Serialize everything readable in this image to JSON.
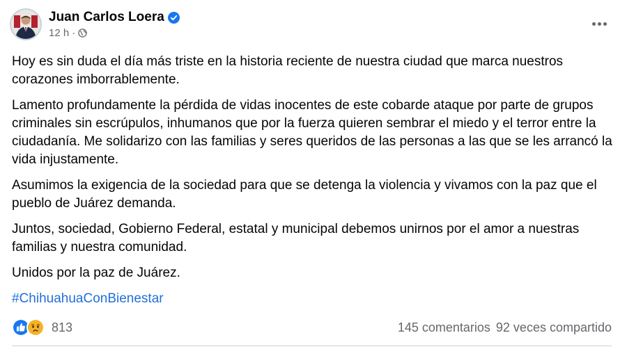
{
  "post": {
    "author": "Juan Carlos Loera",
    "time": "12 h",
    "separator": "·",
    "paragraphs": [
      "Hoy es sin duda el día más triste en la historia reciente de nuestra ciudad que marca nuestros corazones imborrablemente.",
      "Lamento profundamente la pérdida de vidas inocentes de este cobarde ataque por parte de grupos criminales sin escrúpulos, inhumanos que por la fuerza quieren sembrar el miedo y el terror entre la ciudadanía. Me solidarizo con las familias y seres queridos de las personas a las que se les arrancó la vida injustamente.",
      "Asumimos la exigencia de la sociedad para que se detenga la violencia y vivamos con la paz que el pueblo de Juárez demanda.",
      "Juntos, sociedad, Gobierno Federal, estatal y municipal debemos unirnos por el amor a nuestras familias y nuestra comunidad.",
      "Unidos por la paz de Juárez."
    ],
    "hashtag": "#ChihuahuaConBienestar"
  },
  "footer": {
    "reaction_count": "813",
    "comments": "145 comentarios",
    "shares": "92 veces compartido"
  },
  "icons": {
    "verified": "verified-badge-icon",
    "privacy": "globe-icon",
    "more": "more-options-icon",
    "reactions": [
      "like-icon",
      "sad-icon"
    ]
  },
  "colors": {
    "text": "#050505",
    "secondary_text": "#65676b",
    "link": "#216fdb",
    "verified": "#1877f2",
    "like": "#1877f2",
    "sad": "#f7b125"
  }
}
